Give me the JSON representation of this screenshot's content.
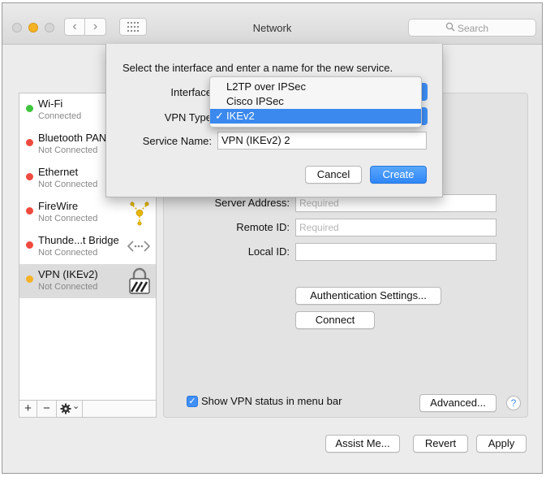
{
  "window": {
    "title": "Network",
    "search_placeholder": "Search",
    "back_glyph": "‹",
    "forward_glyph": "›"
  },
  "services": [
    {
      "name": "Wi-Fi",
      "status": "Connected",
      "dot_color": "#3ec53e",
      "icon": "none"
    },
    {
      "name": "Bluetooth PAN",
      "status": "Not Connected",
      "dot_color": "#ef4a3f",
      "icon": "bluetooth-icon"
    },
    {
      "name": "Ethernet",
      "status": "Not Connected",
      "dot_color": "#ef4a3f",
      "icon": "ethernet-icon"
    },
    {
      "name": "FireWire",
      "status": "Not Connected",
      "dot_color": "#ef4a3f",
      "icon": "firewire-icon"
    },
    {
      "name": "Thunde...t Bridge",
      "status": "Not Connected",
      "dot_color": "#ef4a3f",
      "icon": "thunderbolt-bridge-icon"
    },
    {
      "name": "VPN (IKEv2)",
      "status": "Not Connected",
      "dot_color": "#f5b224",
      "icon": "vpn-lock-icon"
    }
  ],
  "sidebar_footer": {
    "add": "+",
    "remove": "−",
    "gear_caret": "⌄"
  },
  "detail": {
    "server_address_label": "Server Address:",
    "server_address_placeholder": "Required",
    "remote_id_label": "Remote ID:",
    "remote_id_placeholder": "Required",
    "local_id_label": "Local ID:",
    "local_id_value": "",
    "auth_button": "Authentication Settings...",
    "connect_button": "Connect",
    "show_vpn_status_label": "Show VPN status in menu bar",
    "show_vpn_status_checked": true,
    "advanced_button": "Advanced...",
    "help": "?"
  },
  "bottom": {
    "assist": "Assist Me...",
    "revert": "Revert",
    "apply": "Apply"
  },
  "sheet": {
    "prompt": "Select the interface and enter a name for the new service.",
    "interface_label": "Interface",
    "vpn_type_label": "VPN Type",
    "service_name_label": "Service Name:",
    "service_name_value": "VPN (IKEv2) 2",
    "cancel": "Cancel",
    "create": "Create"
  },
  "vpn_type_menu": {
    "options": [
      "L2TP over IPSec",
      "Cisco IPSec",
      "IKEv2"
    ],
    "selected": "IKEv2",
    "check_glyph": "✓"
  },
  "colors": {
    "accent": "#3f8ff7",
    "selection": "#3b89ee",
    "connected": "#3ec53e",
    "not_connected": "#ef4a3f",
    "vpn_pending": "#f5b224"
  }
}
